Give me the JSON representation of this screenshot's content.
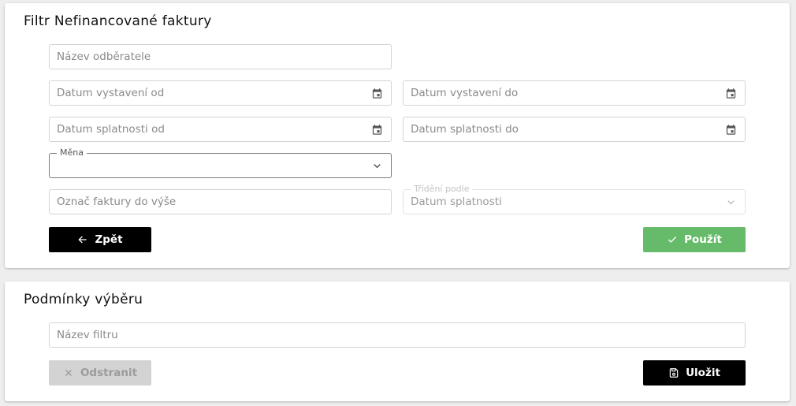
{
  "filter": {
    "title": "Filtr Nefinancované faktury",
    "customer_name": {
      "placeholder": "Název odběratele"
    },
    "issue_date_from": {
      "placeholder": "Datum vystavení od"
    },
    "issue_date_to": {
      "placeholder": "Datum vystavení do"
    },
    "due_date_from": {
      "placeholder": "Datum splatnosti od"
    },
    "due_date_to": {
      "placeholder": "Datum splatnosti do"
    },
    "currency": {
      "label": "Měna",
      "value": ""
    },
    "mark_invoices": {
      "placeholder": "Označ faktury do výše"
    },
    "sort_by": {
      "label": "Třídění podle",
      "value": "Datum splatnosti"
    },
    "back_label": "Zpět",
    "apply_label": "Použít"
  },
  "conditions": {
    "title": "Podmínky výběru",
    "filter_name": {
      "placeholder": "Název filtru"
    },
    "remove_label": "Odstranit",
    "save_label": "Uložit"
  },
  "icons": {
    "date_picker": "calendar-icon",
    "dropdown": "chevron-down-icon",
    "back": "arrow-left-icon",
    "apply": "check-icon",
    "remove": "close-icon",
    "save": "save-icon"
  },
  "colors": {
    "primary_button": "#000000",
    "apply_button": "#66bb6a",
    "disabled_button": "#d3d3d3"
  }
}
